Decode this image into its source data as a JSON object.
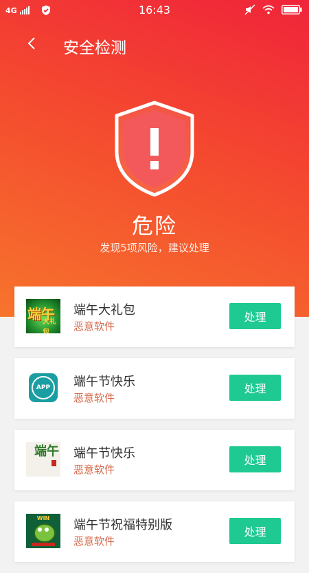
{
  "status_bar": {
    "network": "4G",
    "time": "16:43",
    "battery_level": 1.0
  },
  "header": {
    "title": "安全检测"
  },
  "result": {
    "status": "危险",
    "summary": "发现5项风险，建议处理"
  },
  "colors": {
    "hero_top": "#f0243a",
    "hero_bottom": "#f7742c",
    "action_button": "#1ec992",
    "risk_label": "#d46848"
  },
  "apps": [
    {
      "name": "端午大礼包",
      "type": "恶意软件",
      "action": "处理",
      "icon": "festival-gift-icon",
      "icon_text": "端午",
      "icon_subtext": "大礼包"
    },
    {
      "name": "端午节快乐",
      "type": "恶意软件",
      "action": "处理",
      "icon": "app-icon",
      "icon_text": "APP"
    },
    {
      "name": "端午节快乐",
      "type": "恶意软件",
      "action": "处理",
      "icon": "calligraphy-icon",
      "icon_text": "端午"
    },
    {
      "name": "端午节祝福特别版",
      "type": "恶意软件",
      "action": "处理",
      "icon": "cartoon-win-icon",
      "icon_text": "WIN"
    }
  ]
}
